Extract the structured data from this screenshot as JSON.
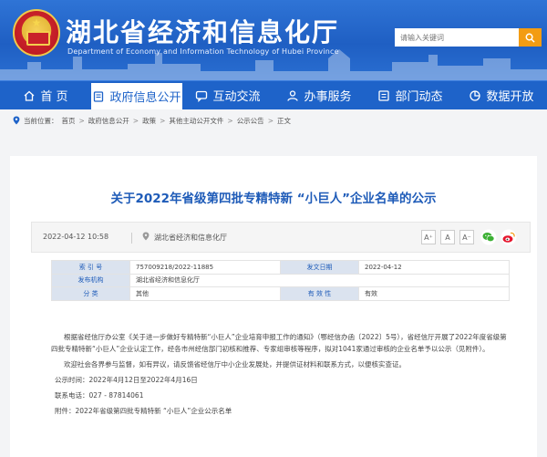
{
  "header": {
    "title": "湖北省经济和信息化厅",
    "subtitle": "Department of Economy and Information Technology of Hubei Province",
    "search_placeholder": "请输入关键词"
  },
  "nav": [
    {
      "label": "首  页",
      "icon": "home-icon"
    },
    {
      "label": "政府信息公开",
      "icon": "document-icon",
      "active": true
    },
    {
      "label": "互动交流",
      "icon": "chat-icon"
    },
    {
      "label": "办事服务",
      "icon": "user-icon"
    },
    {
      "label": "部门动态",
      "icon": "list-icon"
    },
    {
      "label": "数据开放",
      "icon": "chart-icon"
    }
  ],
  "breadcrumb": {
    "prefix": "当前位置：",
    "items": [
      "首页",
      "政府信息公开",
      "政策",
      "其他主动公开文件",
      "公示公告",
      "正文"
    ],
    "sep": ">"
  },
  "article": {
    "title": "关于2022年省级第四批专精特新 “小巨人”企业名单的公示",
    "date": "2022-04-12 10:58",
    "org": "湖北省经济和信息化厅",
    "font_buttons": [
      "A⁺",
      "A",
      "A⁻"
    ]
  },
  "info_table": {
    "row1": {
      "l1": "索  引  号",
      "v1": "757009218/2022-11885",
      "l2": "发文日期",
      "v2": "2022-04-12"
    },
    "row2": {
      "l1": "发布机构",
      "v1": "湖北省经济和信息化厅"
    },
    "row3": {
      "l1": "分    类",
      "v1": "其他",
      "l2": "有 效 性",
      "v2": "有效"
    }
  },
  "body": {
    "p1": "根据省经信厅办公室《关于进一步做好专精特新“小巨人”企业培育申报工作的通知》（鄂经信办函〔2022〕5号），省经信厅开展了2022年度省级第四批专精特新“小巨人”企业认定工作，经各市州经信部门初核和推荐、专家组审核等程序，拟对1041家通过审核的企业名单予以公示（见附件）。",
    "p2": "欢迎社会各界参与监督，如有异议，请反馈省经信厅中小企业发展处，并提供证材料和联系方式，以便核实查证。",
    "p3": "公示时间：2022年4月12日至2022年4月16日",
    "p4": "联系电话：027 - 87814061",
    "p5": "附件：2022年省级第四批专精特新 “小巨人”企业公示名单"
  },
  "colors": {
    "brand": "#1e63c9",
    "title_blue": "#1e5bb8",
    "search_btn": "#f39c12"
  }
}
